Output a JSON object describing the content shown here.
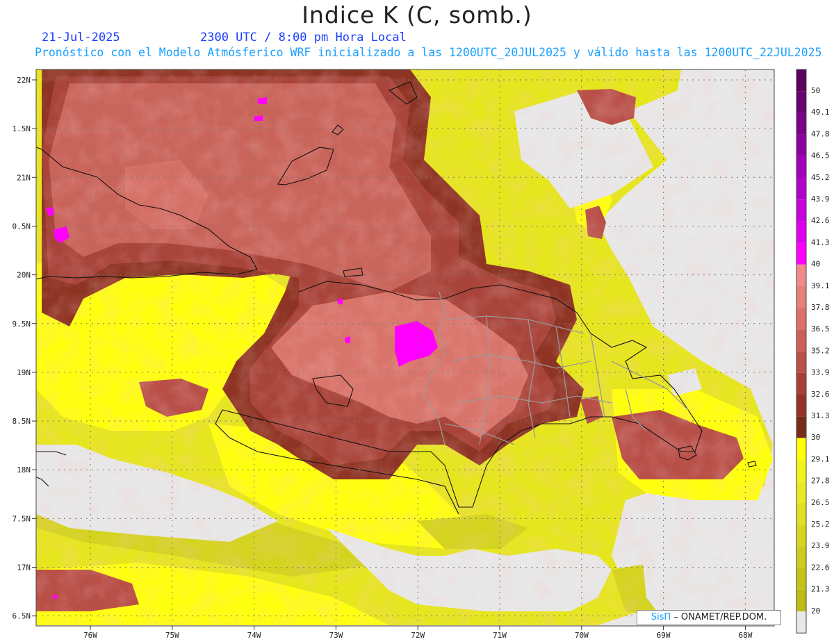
{
  "header": {
    "title": "Indice K (C, somb.)",
    "date": "21-Jul-2025",
    "time": "2300 UTC / 8:00 pm Hora Local",
    "subtitle": "Pronóstico con el Modelo Atmósferico WRF inicializado a las 1200UTC_20JUL2025 y válido hasta las  1200UTC_22JUL2025"
  },
  "map": {
    "lat_labels": [
      "22N",
      "1.5N",
      "21N",
      "0.5N",
      "20N",
      "9.5N",
      "19N",
      "8.5N",
      "18N",
      "7.5N",
      "17N",
      "6.5N"
    ],
    "lon_labels": [
      "76W",
      "75W",
      "74W",
      "73W",
      "72W",
      "71W",
      "70W",
      "69W",
      "68W"
    ],
    "background_color": "#e8e8e8"
  },
  "colorbar": {
    "labels": [
      "50",
      "49.1",
      "47.8",
      "46.5",
      "45.2",
      "43.9",
      "42.6",
      "41.3",
      "40",
      "39.1",
      "37.8",
      "36.5",
      "35.2",
      "33.9",
      "32.6",
      "31.3",
      "30",
      "29.1",
      "27.8",
      "26.5",
      "25.2",
      "23.9",
      "22.6",
      "21.3",
      "20"
    ],
    "colors": [
      "#5c005c",
      "#6a0070",
      "#7a0088",
      "#8c00a0",
      "#a000b8",
      "#b400cc",
      "#c800dc",
      "#e000ee",
      "#ff00ff",
      "#f28a8a",
      "#e8807a",
      "#dd706a",
      "#cc6058",
      "#bb5048",
      "#a84038",
      "#963028",
      "#7a2a18",
      "#ffff00",
      "#f4f41a",
      "#eaea22",
      "#e0e024",
      "#d6d620",
      "#cccc1c",
      "#c4c418",
      "#bcbc14",
      "#e8e8e8"
    ]
  },
  "credit": {
    "brand": "SisΠ",
    "text": " – ONAMET/REP.DOM."
  }
}
